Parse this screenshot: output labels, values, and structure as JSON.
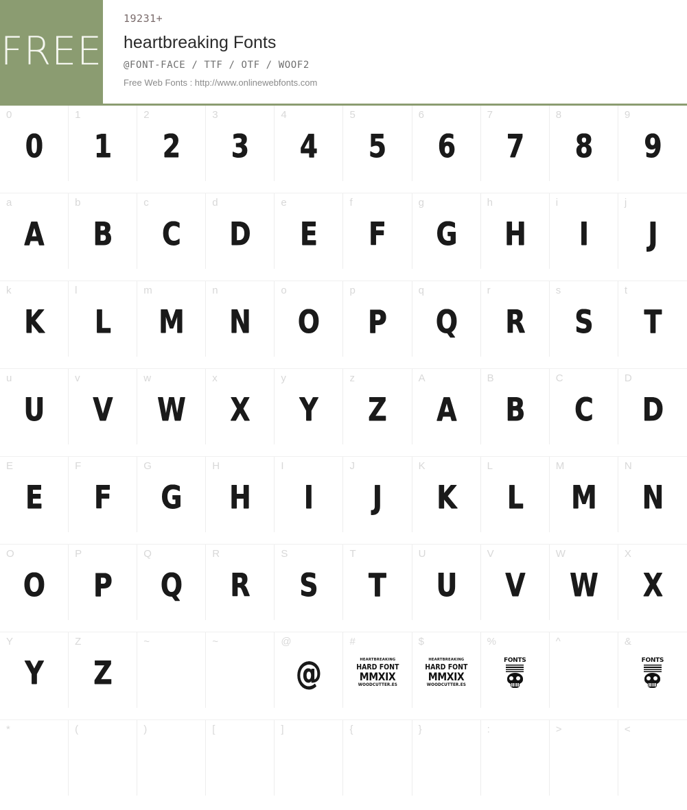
{
  "header": {
    "badge_label": "FREE",
    "count": "19231+",
    "title": "heartbreaking Fonts",
    "formats": "@FONT-FACE / TTF / OTF / WOOF2",
    "source": "Free Web Fonts : http://www.onlinewebfonts.com",
    "accent_color": "#8b9c71",
    "badge_text_color": "#f4f6ef"
  },
  "grid": {
    "columns": 10,
    "rows": [
      {
        "cells": [
          {
            "label": "0",
            "glyph": "0",
            "kind": "text"
          },
          {
            "label": "1",
            "glyph": "1",
            "kind": "text"
          },
          {
            "label": "2",
            "glyph": "2",
            "kind": "text"
          },
          {
            "label": "3",
            "glyph": "3",
            "kind": "text"
          },
          {
            "label": "4",
            "glyph": "4",
            "kind": "text"
          },
          {
            "label": "5",
            "glyph": "5",
            "kind": "text"
          },
          {
            "label": "6",
            "glyph": "6",
            "kind": "text"
          },
          {
            "label": "7",
            "glyph": "7",
            "kind": "text"
          },
          {
            "label": "8",
            "glyph": "8",
            "kind": "text"
          },
          {
            "label": "9",
            "glyph": "9",
            "kind": "text"
          }
        ]
      },
      {
        "cells": [
          {
            "label": "a",
            "glyph": "A",
            "kind": "text"
          },
          {
            "label": "b",
            "glyph": "B",
            "kind": "text"
          },
          {
            "label": "c",
            "glyph": "C",
            "kind": "text"
          },
          {
            "label": "d",
            "glyph": "D",
            "kind": "text"
          },
          {
            "label": "e",
            "glyph": "E",
            "kind": "text"
          },
          {
            "label": "f",
            "glyph": "F",
            "kind": "text"
          },
          {
            "label": "g",
            "glyph": "G",
            "kind": "text"
          },
          {
            "label": "h",
            "glyph": "H",
            "kind": "text"
          },
          {
            "label": "i",
            "glyph": "I",
            "kind": "text"
          },
          {
            "label": "j",
            "glyph": "J",
            "kind": "text"
          }
        ]
      },
      {
        "cells": [
          {
            "label": "k",
            "glyph": "K",
            "kind": "text"
          },
          {
            "label": "l",
            "glyph": "L",
            "kind": "text"
          },
          {
            "label": "m",
            "glyph": "M",
            "kind": "text"
          },
          {
            "label": "n",
            "glyph": "N",
            "kind": "text"
          },
          {
            "label": "o",
            "glyph": "O",
            "kind": "text"
          },
          {
            "label": "p",
            "glyph": "P",
            "kind": "text"
          },
          {
            "label": "q",
            "glyph": "Q",
            "kind": "text"
          },
          {
            "label": "r",
            "glyph": "R",
            "kind": "text"
          },
          {
            "label": "s",
            "glyph": "S",
            "kind": "text"
          },
          {
            "label": "t",
            "glyph": "T",
            "kind": "text"
          }
        ]
      },
      {
        "cells": [
          {
            "label": "u",
            "glyph": "U",
            "kind": "text"
          },
          {
            "label": "v",
            "glyph": "V",
            "kind": "text"
          },
          {
            "label": "w",
            "glyph": "W",
            "kind": "text"
          },
          {
            "label": "x",
            "glyph": "X",
            "kind": "text"
          },
          {
            "label": "y",
            "glyph": "Y",
            "kind": "text"
          },
          {
            "label": "z",
            "glyph": "Z",
            "kind": "text"
          },
          {
            "label": "A",
            "glyph": "A",
            "kind": "text"
          },
          {
            "label": "B",
            "glyph": "B",
            "kind": "text"
          },
          {
            "label": "C",
            "glyph": "C",
            "kind": "text"
          },
          {
            "label": "D",
            "glyph": "D",
            "kind": "text"
          }
        ]
      },
      {
        "cells": [
          {
            "label": "E",
            "glyph": "E",
            "kind": "text"
          },
          {
            "label": "F",
            "glyph": "F",
            "kind": "text"
          },
          {
            "label": "G",
            "glyph": "G",
            "kind": "text"
          },
          {
            "label": "H",
            "glyph": "H",
            "kind": "text"
          },
          {
            "label": "I",
            "glyph": "I",
            "kind": "text"
          },
          {
            "label": "J",
            "glyph": "J",
            "kind": "text"
          },
          {
            "label": "K",
            "glyph": "K",
            "kind": "text"
          },
          {
            "label": "L",
            "glyph": "L",
            "kind": "text"
          },
          {
            "label": "M",
            "glyph": "M",
            "kind": "text"
          },
          {
            "label": "N",
            "glyph": "N",
            "kind": "text"
          }
        ]
      },
      {
        "cells": [
          {
            "label": "O",
            "glyph": "O",
            "kind": "text"
          },
          {
            "label": "P",
            "glyph": "P",
            "kind": "text"
          },
          {
            "label": "Q",
            "glyph": "Q",
            "kind": "text"
          },
          {
            "label": "R",
            "glyph": "R",
            "kind": "text"
          },
          {
            "label": "S",
            "glyph": "S",
            "kind": "text"
          },
          {
            "label": "T",
            "glyph": "T",
            "kind": "text"
          },
          {
            "label": "U",
            "glyph": "U",
            "kind": "text"
          },
          {
            "label": "V",
            "glyph": "V",
            "kind": "text"
          },
          {
            "label": "W",
            "glyph": "W",
            "kind": "text"
          },
          {
            "label": "X",
            "glyph": "X",
            "kind": "text"
          }
        ]
      },
      {
        "cells": [
          {
            "label": "Y",
            "glyph": "Y",
            "kind": "text"
          },
          {
            "label": "Z",
            "glyph": "Z",
            "kind": "text"
          },
          {
            "label": "~",
            "glyph": "",
            "kind": "empty"
          },
          {
            "label": "~",
            "glyph": "",
            "kind": "empty"
          },
          {
            "label": "@",
            "glyph": "@",
            "kind": "text"
          },
          {
            "label": "#",
            "glyph": "",
            "kind": "logo-block"
          },
          {
            "label": "$",
            "glyph": "",
            "kind": "logo-block"
          },
          {
            "label": "%",
            "glyph": "",
            "kind": "skull-logo"
          },
          {
            "label": "^",
            "glyph": "",
            "kind": "empty"
          },
          {
            "label": "&",
            "glyph": "",
            "kind": "skull-logo"
          }
        ]
      },
      {
        "cells": [
          {
            "label": "*",
            "glyph": "",
            "kind": "empty"
          },
          {
            "label": "(",
            "glyph": "",
            "kind": "empty"
          },
          {
            "label": ")",
            "glyph": "",
            "kind": "empty"
          },
          {
            "label": "[",
            "glyph": "",
            "kind": "empty"
          },
          {
            "label": "]",
            "glyph": "",
            "kind": "empty"
          },
          {
            "label": "{",
            "glyph": "",
            "kind": "empty"
          },
          {
            "label": "}",
            "glyph": "",
            "kind": "empty"
          },
          {
            "label": ":",
            "glyph": "",
            "kind": "empty"
          },
          {
            "label": ">",
            "glyph": "",
            "kind": "empty"
          },
          {
            "label": "<",
            "glyph": "",
            "kind": "empty"
          }
        ]
      }
    ]
  },
  "logo_block": {
    "line1": "HEARTBREAKING",
    "line2": "HARD FONT",
    "line3": "MMXIX",
    "line4": "WOODCUTTER.ES"
  },
  "skull_logo": {
    "top_text": "FONTS"
  }
}
